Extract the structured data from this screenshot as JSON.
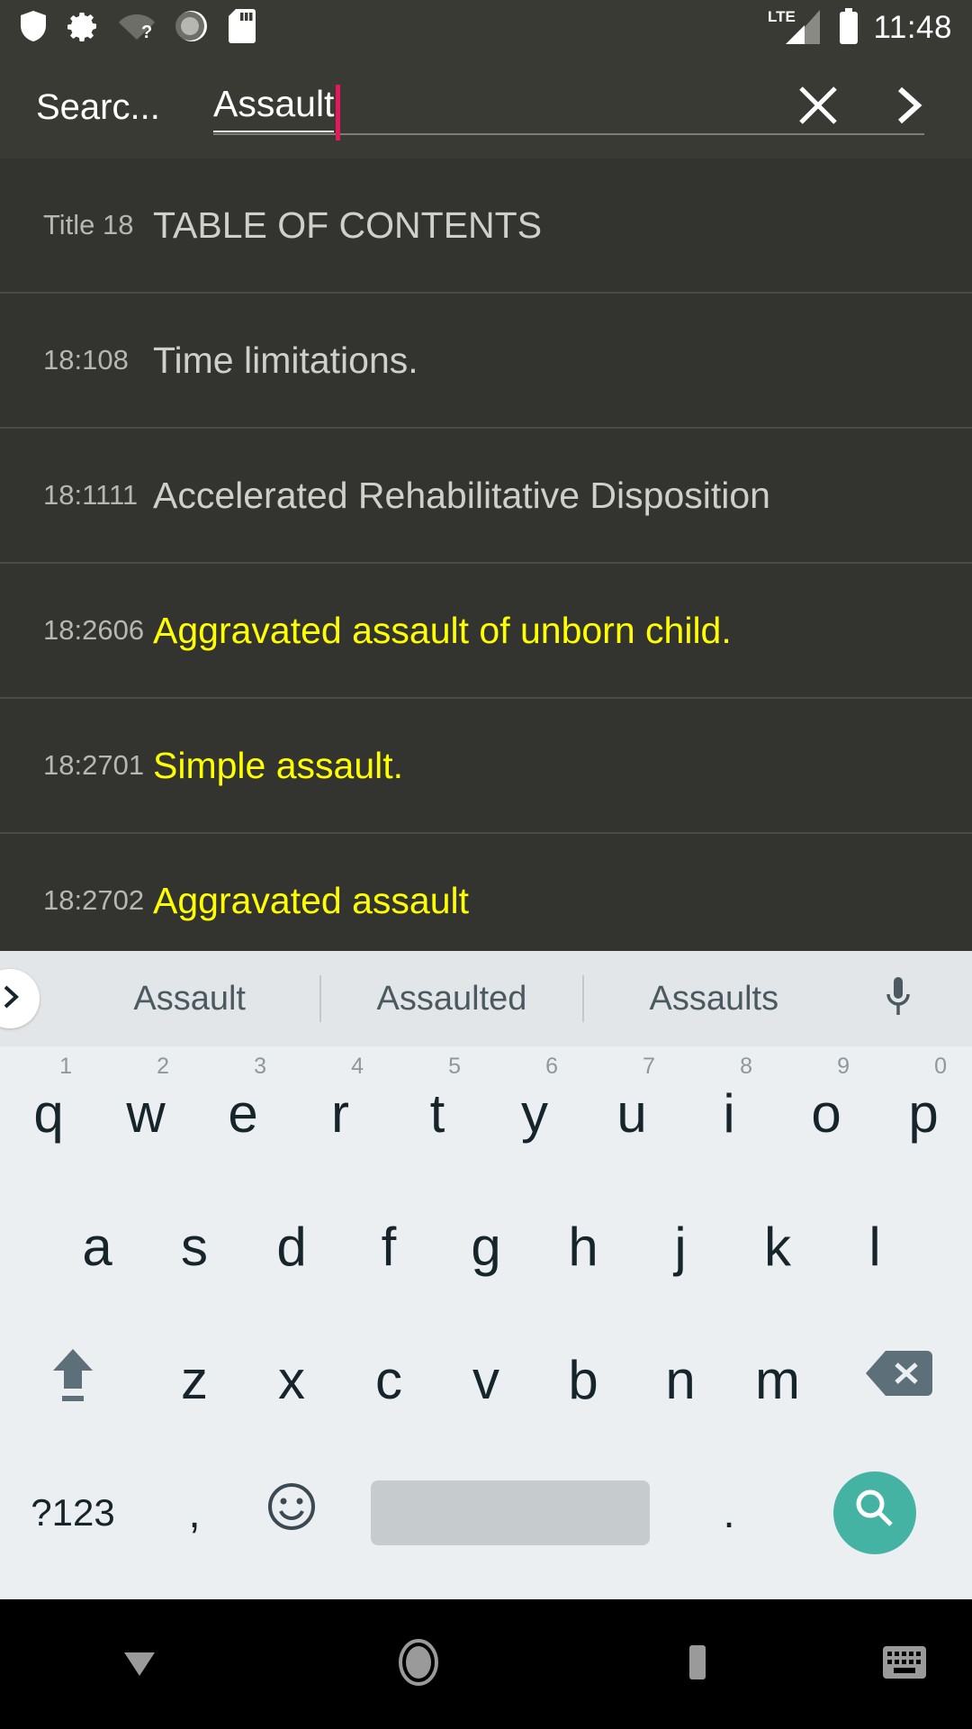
{
  "status_bar": {
    "clock": "11:48",
    "network_label": "LTE",
    "icons": [
      {
        "name": "shield-icon"
      },
      {
        "name": "gear-icon"
      },
      {
        "name": "wifi-question-icon"
      },
      {
        "name": "sync-circle-icon"
      },
      {
        "name": "sd-card-icon"
      }
    ],
    "right_icons": [
      {
        "name": "signal-lte-icon"
      },
      {
        "name": "battery-full-icon"
      }
    ]
  },
  "search_bar": {
    "label": "Searc...",
    "query": "Assault",
    "clear_icon": "close-icon",
    "next_icon": "chevron-right-icon"
  },
  "results": {
    "columns": [
      "code",
      "title"
    ],
    "rows": [
      {
        "code": "Title 18",
        "title": "TABLE OF CONTENTS",
        "highlight": false
      },
      {
        "code": "18:108",
        "title": "Time limitations.",
        "highlight": false
      },
      {
        "code": "18:1111",
        "title": "Accelerated Rehabilitative Disposition",
        "highlight": false
      },
      {
        "code": "18:2606",
        "title": "Aggravated assault of unborn child.",
        "highlight": true
      },
      {
        "code": "18:2701",
        "title": "Simple assault.",
        "highlight": true
      },
      {
        "code": "18:2702",
        "title": "Aggravated assault",
        "highlight": true
      }
    ],
    "highlight_color": "#ffff00",
    "text_color": "#cfcfcb",
    "code_color": "#b6b6b2"
  },
  "keyboard": {
    "suggestions": [
      "Assault",
      "Assaulted",
      "Assaults"
    ],
    "expand_icon": "chevron-right-icon",
    "mic_icon": "microphone-icon",
    "row1": [
      {
        "letter": "q",
        "hint": "1"
      },
      {
        "letter": "w",
        "hint": "2"
      },
      {
        "letter": "e",
        "hint": "3"
      },
      {
        "letter": "r",
        "hint": "4"
      },
      {
        "letter": "t",
        "hint": "5"
      },
      {
        "letter": "y",
        "hint": "6"
      },
      {
        "letter": "u",
        "hint": "7"
      },
      {
        "letter": "i",
        "hint": "8"
      },
      {
        "letter": "o",
        "hint": "9"
      },
      {
        "letter": "p",
        "hint": "0"
      }
    ],
    "row2": [
      "a",
      "s",
      "d",
      "f",
      "g",
      "h",
      "j",
      "k",
      "l"
    ],
    "row3": [
      "z",
      "x",
      "c",
      "v",
      "b",
      "n",
      "m"
    ],
    "shift_icon": "shift-arrow-icon",
    "backspace_icon": "backspace-icon",
    "symbols_label": "?123",
    "comma_label": ",",
    "emoji_icon": "emoji-smiley-icon",
    "space_label": "",
    "period_label": ".",
    "enter_icon": "search-icon",
    "enter_color": "#45b3a3"
  },
  "nav_bar": {
    "back_icon": "dismiss-keyboard-down-icon",
    "home_icon": "home-circle-icon",
    "recents_icon": "recents-square-icon",
    "keyboard_switch_icon": "keyboard-switch-icon"
  }
}
